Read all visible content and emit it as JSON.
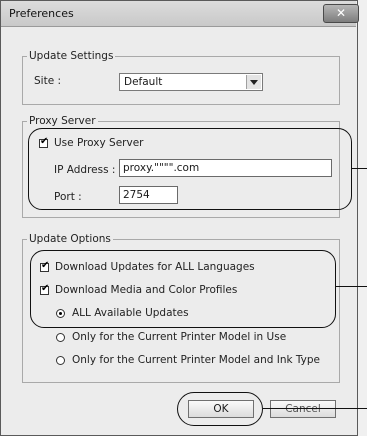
{
  "window": {
    "title": "Preferences",
    "close_glyph": "✕"
  },
  "update_settings": {
    "legend": "Update Settings",
    "site_label": "Site :",
    "site_value": "Default"
  },
  "proxy": {
    "legend": "Proxy Server",
    "use_proxy_label": "Use Proxy Server",
    "use_proxy_checked": true,
    "ip_label": "IP Address :",
    "ip_value": "proxy.\"\"\"\".com",
    "port_label": "Port :",
    "port_value": "2754"
  },
  "update_options": {
    "legend": "Update Options",
    "download_langs_label": "Download Updates for ALL Languages",
    "download_langs_checked": true,
    "download_media_label": "Download Media and Color Profiles",
    "download_media_checked": true,
    "radios": [
      {
        "label": "ALL Available Updates",
        "selected": true
      },
      {
        "label": "Only for the Current Printer Model in Use",
        "selected": false
      },
      {
        "label": "Only for the Current Printer Model and Ink Type",
        "selected": false
      }
    ]
  },
  "buttons": {
    "ok_label": "OK",
    "cancel_label": "Cancel"
  },
  "icons": {
    "combo_arrow": "chevron-down-icon",
    "check": "checkmark-icon",
    "close": "close-icon"
  }
}
